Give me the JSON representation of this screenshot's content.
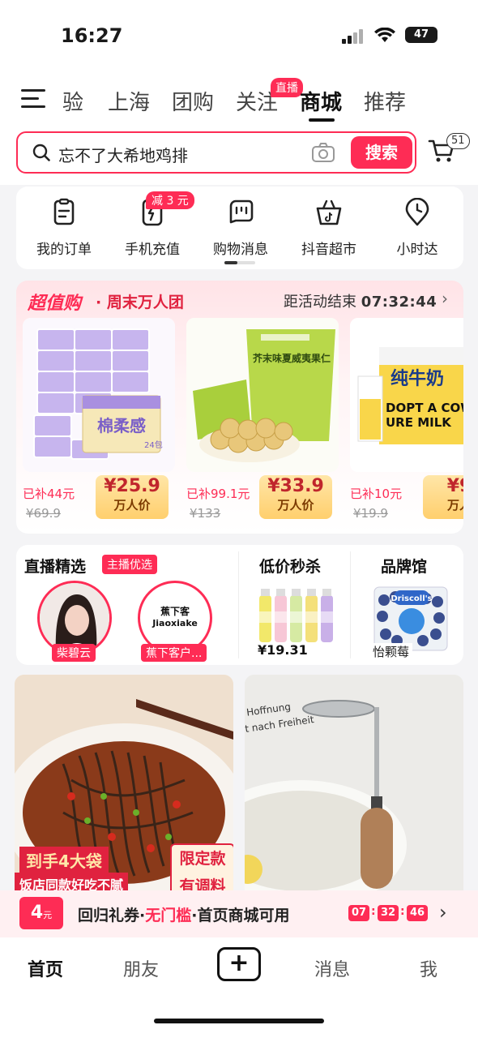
{
  "status_bar": {
    "time": "16:27",
    "battery": "47"
  },
  "top_nav": {
    "tabs": [
      {
        "label": "验"
      },
      {
        "label": "上海"
      },
      {
        "label": "团购"
      },
      {
        "label": "关注"
      },
      {
        "label": "商城"
      },
      {
        "label": "推荐"
      }
    ],
    "active_tab": "商城",
    "live_badge": "直播"
  },
  "search": {
    "query": "忘不了大希地鸡排",
    "button": "搜索",
    "cart_count": "51"
  },
  "shortcuts": {
    "items": [
      {
        "label": "我的订单",
        "icon": "order-icon"
      },
      {
        "label": "手机充值",
        "icon": "phone-charge-icon"
      },
      {
        "label": "购物消息",
        "icon": "shopping-message-icon"
      },
      {
        "label": "抖音超市",
        "icon": "supermarket-basket-icon"
      },
      {
        "label": "小时达",
        "icon": "location-clock-icon"
      }
    ],
    "charge_badge": "减 3 元"
  },
  "promo": {
    "brand": "超值购",
    "subtitle": "· 周末万人团",
    "countdown_label": "距活动结束",
    "countdown_time": "07:32:44",
    "products": [
      {
        "subsidy": "已补44元",
        "price": "¥25.9",
        "tag": "万人价",
        "original": "¥69.9",
        "image": "tissue"
      },
      {
        "subsidy": "已补99.1元",
        "price": "¥33.9",
        "tag": "万人价",
        "original": "¥133",
        "image": "macadamia"
      },
      {
        "subsidy": "已补10元",
        "price": "¥9",
        "tag": "万人",
        "original": "¥19.9",
        "image": "milk"
      }
    ]
  },
  "features": {
    "live_title": "直播精选",
    "live_badge": "主播优选",
    "anchors": [
      {
        "name": "柴碧云"
      },
      {
        "name": "蕉下客户...",
        "logo_text": "蕉下客",
        "logo_sub": "Jiaoxiake"
      }
    ],
    "flash_title": "低价秒杀",
    "flash_price": "¥19.31",
    "brand_title": "品牌馆",
    "brand_item": "怡颗莓"
  },
  "feed": {
    "noodle": {
      "tag1": "到手4大袋",
      "tag2": "饭店同款好吃不腻",
      "tag3a": "限定款",
      "tag3b": "有调料"
    },
    "masher": {
      "caption1": "Hoffnung",
      "caption2": "t nach Freiheit"
    }
  },
  "coupon": {
    "value": "4",
    "unit": "元",
    "text_pre": "回归礼券·",
    "text_hl": "无门槛",
    "text_post": "·首页商城可用",
    "h": "07",
    "m": "32",
    "s": "46"
  },
  "tabbar": {
    "home": "首页",
    "friends": "朋友",
    "messages": "消息",
    "me": "我"
  },
  "colors": {
    "accent": "#fe2c55",
    "gold": "#ffcf6d"
  }
}
